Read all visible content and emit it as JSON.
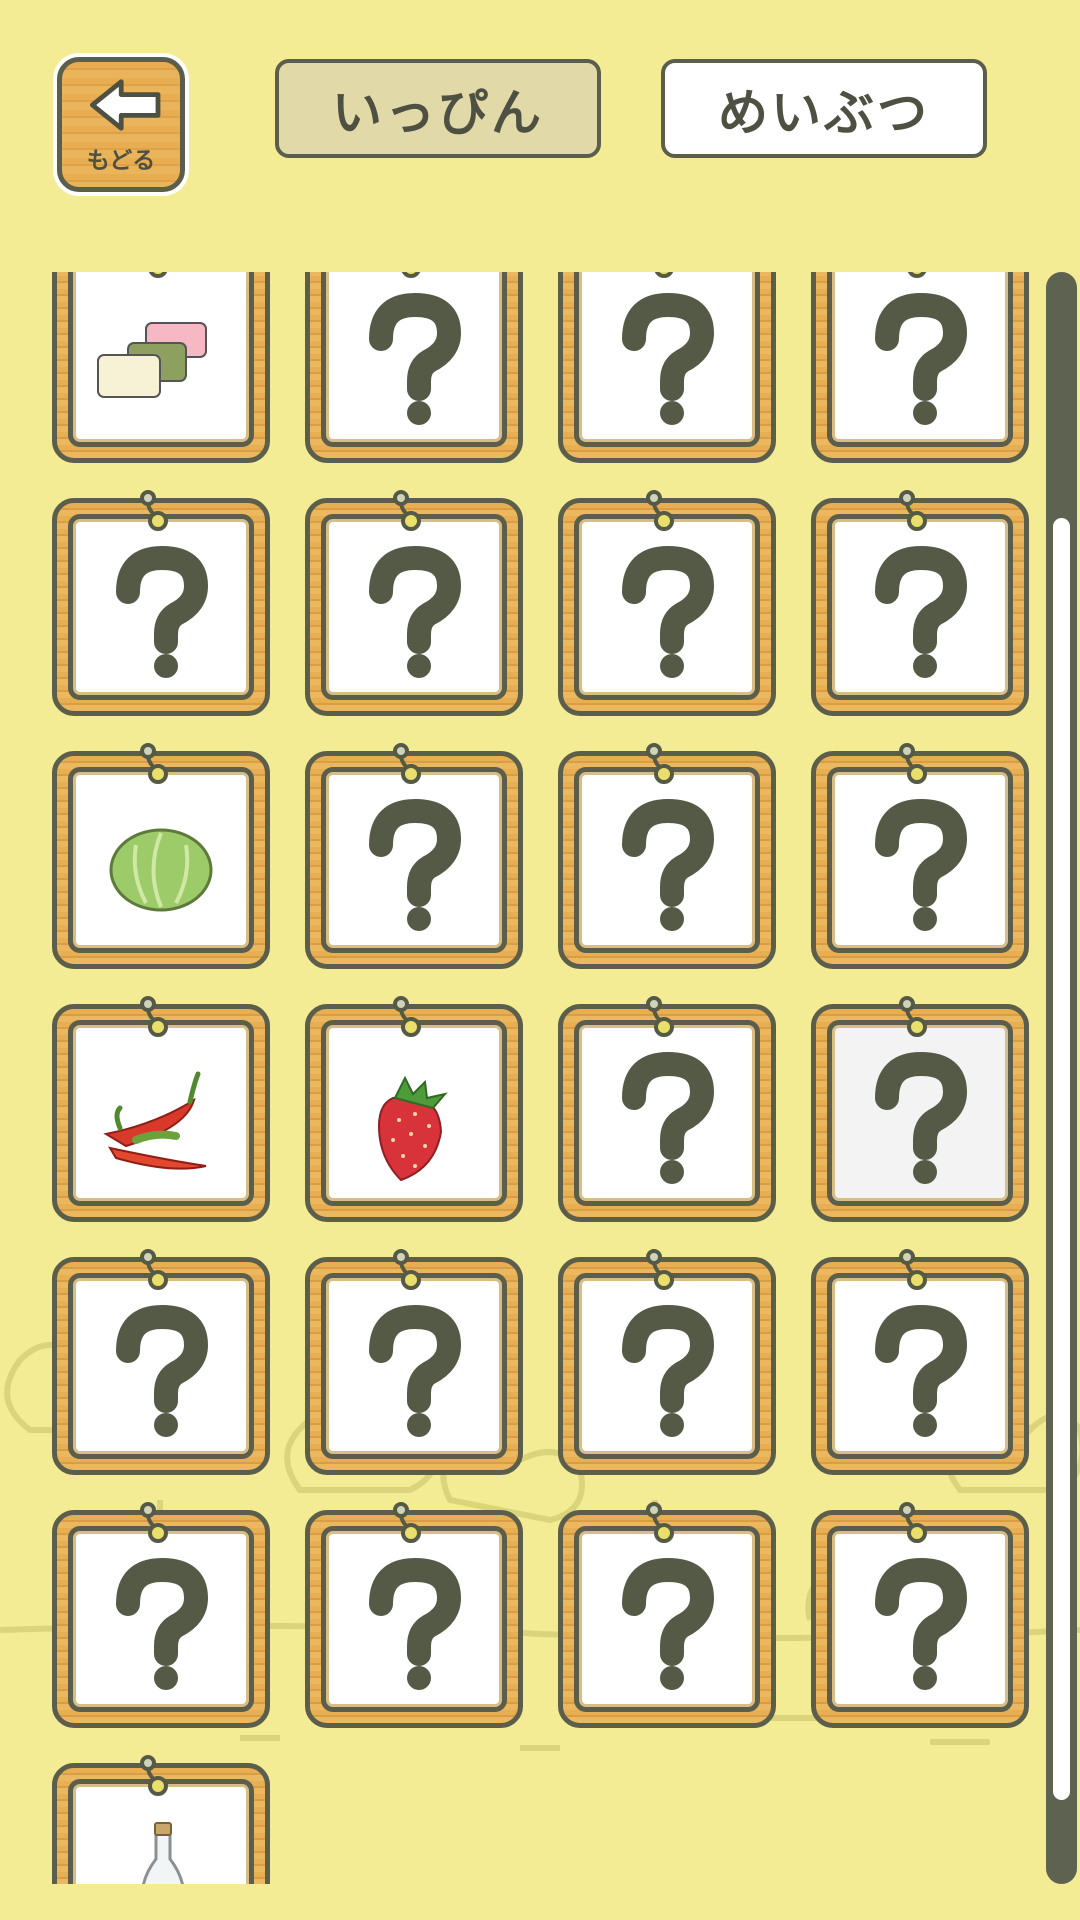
{
  "header": {
    "back_label": "もどる",
    "tabs": [
      {
        "label": "いっぴん",
        "active": true
      },
      {
        "label": "めいぶつ",
        "active": false
      }
    ]
  },
  "grid": {
    "items": [
      {
        "icon": "sweets-icon",
        "unlocked": true
      },
      {
        "icon": "question-mark-icon",
        "unlocked": false
      },
      {
        "icon": "question-mark-icon",
        "unlocked": false
      },
      {
        "icon": "question-mark-icon",
        "unlocked": false
      },
      {
        "icon": "question-mark-icon",
        "unlocked": false
      },
      {
        "icon": "question-mark-icon",
        "unlocked": false
      },
      {
        "icon": "question-mark-icon",
        "unlocked": false
      },
      {
        "icon": "question-mark-icon",
        "unlocked": false
      },
      {
        "icon": "cabbage-icon",
        "unlocked": true
      },
      {
        "icon": "question-mark-icon",
        "unlocked": false
      },
      {
        "icon": "question-mark-icon",
        "unlocked": false
      },
      {
        "icon": "question-mark-icon",
        "unlocked": false
      },
      {
        "icon": "chili-pepper-icon",
        "unlocked": true
      },
      {
        "icon": "strawberry-icon",
        "unlocked": true
      },
      {
        "icon": "question-mark-icon",
        "unlocked": false
      },
      {
        "icon": "question-mark-icon",
        "unlocked": false,
        "selected": true
      },
      {
        "icon": "question-mark-icon",
        "unlocked": false
      },
      {
        "icon": "question-mark-icon",
        "unlocked": false
      },
      {
        "icon": "question-mark-icon",
        "unlocked": false
      },
      {
        "icon": "question-mark-icon",
        "unlocked": false
      },
      {
        "icon": "question-mark-icon",
        "unlocked": false
      },
      {
        "icon": "question-mark-icon",
        "unlocked": false
      },
      {
        "icon": "question-mark-icon",
        "unlocked": false
      },
      {
        "icon": "question-mark-icon",
        "unlocked": false
      },
      {
        "icon": "bottle-icon",
        "unlocked": true
      }
    ]
  },
  "colors": {
    "background": "#f3ec95",
    "ink": "#5b5e4b",
    "wood": "#e8ae52",
    "tab_active": "#e2d9a9"
  }
}
